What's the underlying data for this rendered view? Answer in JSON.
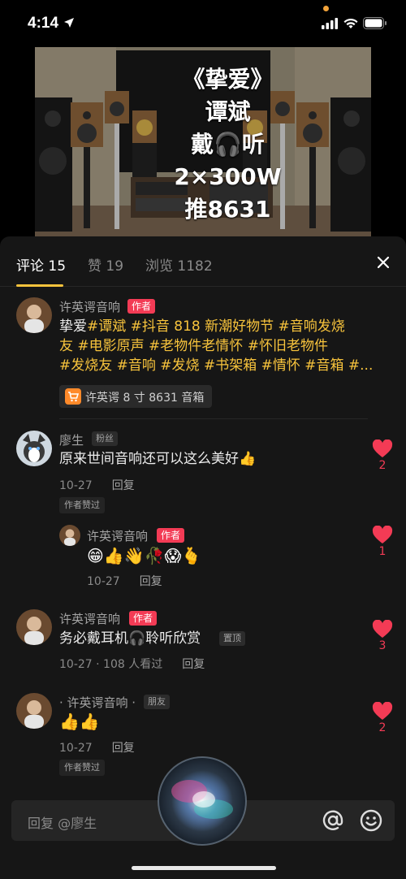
{
  "status": {
    "time": "4:14"
  },
  "video": {
    "lines": [
      "《挚爱》",
      "谭斌",
      "戴🎧听",
      "2×300W",
      "推8631"
    ]
  },
  "tabs": {
    "comments": "评论 15",
    "likes": "赞 19",
    "views": "浏览 1182"
  },
  "main_comment": {
    "user": "许英谔音响",
    "badge": "作者",
    "segments": [
      [
        {
          "t": "挚爱",
          "tag": false
        },
        {
          "t": "#谭斌 #抖音 818 新潮好物节 #音响发烧",
          "tag": true
        }
      ],
      [
        {
          "t": "友 #电影原声 #老物件老情怀 #怀旧老物件",
          "tag": true
        }
      ],
      [
        {
          "t": "#发烧友 #音响 #发烧 #书架箱 #情怀 #音箱 #...",
          "tag": true
        }
      ]
    ],
    "product": "许英谔 8 寸 8631 音箱"
  },
  "comments": [
    {
      "user": "廖生",
      "badge": "粉丝",
      "text": "原来世间音响还可以这么美好👍",
      "date": "10-27",
      "reply": "回复",
      "liked_tag": "作者赞过",
      "likes": "2"
    },
    {
      "user": "许英谔音响",
      "badge": "作者",
      "text": "😁👍👋🥀😱🫰",
      "date": "10-27",
      "reply": "回复",
      "likes": "1"
    },
    {
      "user": "许英谔音响",
      "badge": "作者",
      "text": "务必戴耳机🎧聆听欣赏",
      "pinned": "置顶",
      "date": "10-27 · 108 人看过",
      "reply": "回复",
      "likes": "3"
    },
    {
      "user": "· 许英谔音响 ·",
      "badge": "朋友",
      "text": "👍👍",
      "date": "10-27",
      "reply": "回复",
      "liked_tag": "作者赞过",
      "likes": "2"
    }
  ],
  "input": {
    "placeholder": "回复 @廖生"
  },
  "colors": {
    "accent_tag": "#f7c33c",
    "author_badge": "#f33b55",
    "heart": "#f33b55",
    "sheet_bg": "#161616"
  },
  "icons": [
    "location-arrow-icon",
    "signal-icon",
    "wifi-icon",
    "battery-icon",
    "close-icon",
    "cart-icon",
    "heart-icon",
    "at-icon",
    "emoji-icon",
    "siri-orb"
  ]
}
